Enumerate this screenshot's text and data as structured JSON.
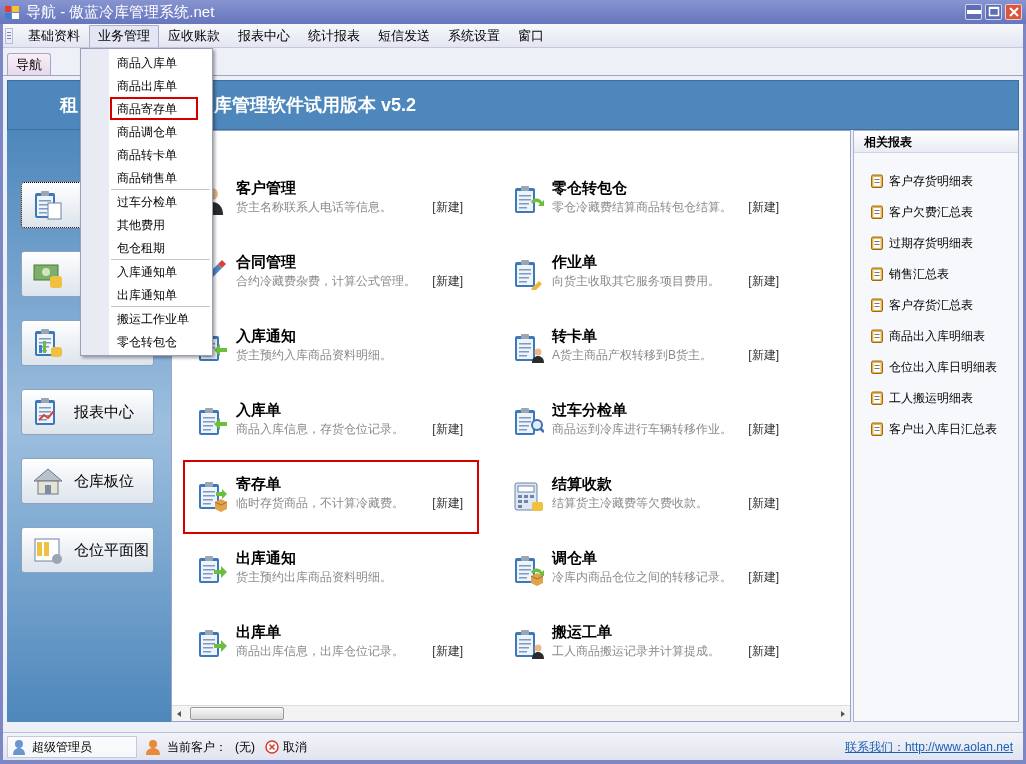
{
  "window": {
    "title": "导航 - 傲蓝冷库管理系统.net"
  },
  "menu_bar": [
    {
      "label": "基础资料",
      "selected": false
    },
    {
      "label": "业务管理",
      "selected": true
    },
    {
      "label": "应收账款",
      "selected": false
    },
    {
      "label": "报表中心",
      "selected": false
    },
    {
      "label": "统计报表",
      "selected": false
    },
    {
      "label": "短信发送",
      "selected": false
    },
    {
      "label": "系统设置",
      "selected": false
    },
    {
      "label": "窗口",
      "selected": false
    }
  ],
  "dropdown": {
    "groups": [
      [
        {
          "label": "商品入库单",
          "highlighted": false
        },
        {
          "label": "商品出库单",
          "highlighted": false
        },
        {
          "label": "商品寄存单",
          "highlighted": true
        },
        {
          "label": "商品调仓单",
          "highlighted": false
        },
        {
          "label": "商品转卡单",
          "highlighted": false
        },
        {
          "label": "商品销售单",
          "highlighted": false
        }
      ],
      [
        {
          "label": "过车分检单",
          "highlighted": false
        },
        {
          "label": "其他费用",
          "highlighted": false
        },
        {
          "label": "包仓租期",
          "highlighted": false
        }
      ],
      [
        {
          "label": "入库通知单",
          "highlighted": false
        },
        {
          "label": "出库通知单",
          "highlighted": false
        }
      ],
      [
        {
          "label": "搬运工作业单",
          "highlighted": false
        },
        {
          "label": "零仓转包仓",
          "highlighted": false
        }
      ]
    ]
  },
  "tabs": [
    {
      "label": "导航",
      "selected": true
    }
  ],
  "banner": {
    "left_text": "租",
    "right_text": "库管理软件试用版本 v5.2"
  },
  "nav_buttons": [
    {
      "kind": "covered",
      "focused": true
    },
    {
      "kind": "covered",
      "focused": false
    },
    {
      "kind": "covered",
      "focused": false
    },
    {
      "kind": "labeled",
      "label": "报表中心",
      "focused": false
    },
    {
      "kind": "labeled",
      "label": "仓库板位",
      "focused": false
    },
    {
      "kind": "labeled",
      "label": "仓位平面图",
      "focused": false
    }
  ],
  "modules": [
    {
      "title": "客户管理",
      "description": "货主名称联系人电话等信息。",
      "new_link": "[新建]",
      "highlighted": false
    },
    {
      "title": "零仓转包仓",
      "description": "零仓冷藏费结算商品转包仓结算。",
      "new_link": "[新建]",
      "highlighted": false
    },
    {
      "title": "合同管理",
      "description": "合约冷藏费杂费，计算公式管理。",
      "new_link": "[新建]",
      "highlighted": false
    },
    {
      "title": "作业单",
      "description": "向货主收取其它服务项目费用。",
      "new_link": "[新建]",
      "highlighted": false
    },
    {
      "title": "入库通知",
      "description": "货主预约入库商品资料明细。",
      "highlighted": false
    },
    {
      "title": "转卡单",
      "description": "A货主商品产权转移到B货主。",
      "new_link": "[新建]",
      "highlighted": false
    },
    {
      "title": "入库单",
      "description": "商品入库信息，存货仓位记录。",
      "new_link": "[新建]",
      "highlighted": false
    },
    {
      "title": "过车分检单",
      "description": "商品运到冷库进行车辆转移作业。",
      "new_link": "[新建]",
      "highlighted": false
    },
    {
      "title": "寄存单",
      "description": "临时存货商品，不计算冷藏费。",
      "new_link": "[新建]",
      "highlighted": true
    },
    {
      "title": "结算收款",
      "description": "结算货主冷藏费等欠费收款。",
      "new_link": "[新建]",
      "highlighted": false
    },
    {
      "title": "出库通知",
      "description": "货主预约出库商品资料明细。",
      "highlighted": false
    },
    {
      "title": "调仓单",
      "description": "冷库内商品仓位之间的转移记录。",
      "new_link": "[新建]",
      "highlighted": false
    },
    {
      "title": "出库单",
      "description": "商品出库信息，出库仓位记录。",
      "new_link": "[新建]",
      "highlighted": false
    },
    {
      "title": "搬运工单",
      "description": "工人商品搬运记录并计算提成。",
      "new_link": "[新建]",
      "highlighted": false
    }
  ],
  "related_reports": {
    "title": "相关报表",
    "items": [
      "客户存货明细表",
      "客户欠费汇总表",
      "过期存货明细表",
      "销售汇总表",
      "客户存货汇总表",
      "商品出入库明细表",
      "仓位出入库日明细表",
      "工人搬运明细表",
      "客户出入库日汇总表"
    ]
  },
  "status_bar": {
    "user": "超级管理员",
    "customer_label": "当前客户：",
    "customer_value": "(无)",
    "cancel": "取消",
    "contact_link": "联系我们：http://www.aolan.net"
  }
}
